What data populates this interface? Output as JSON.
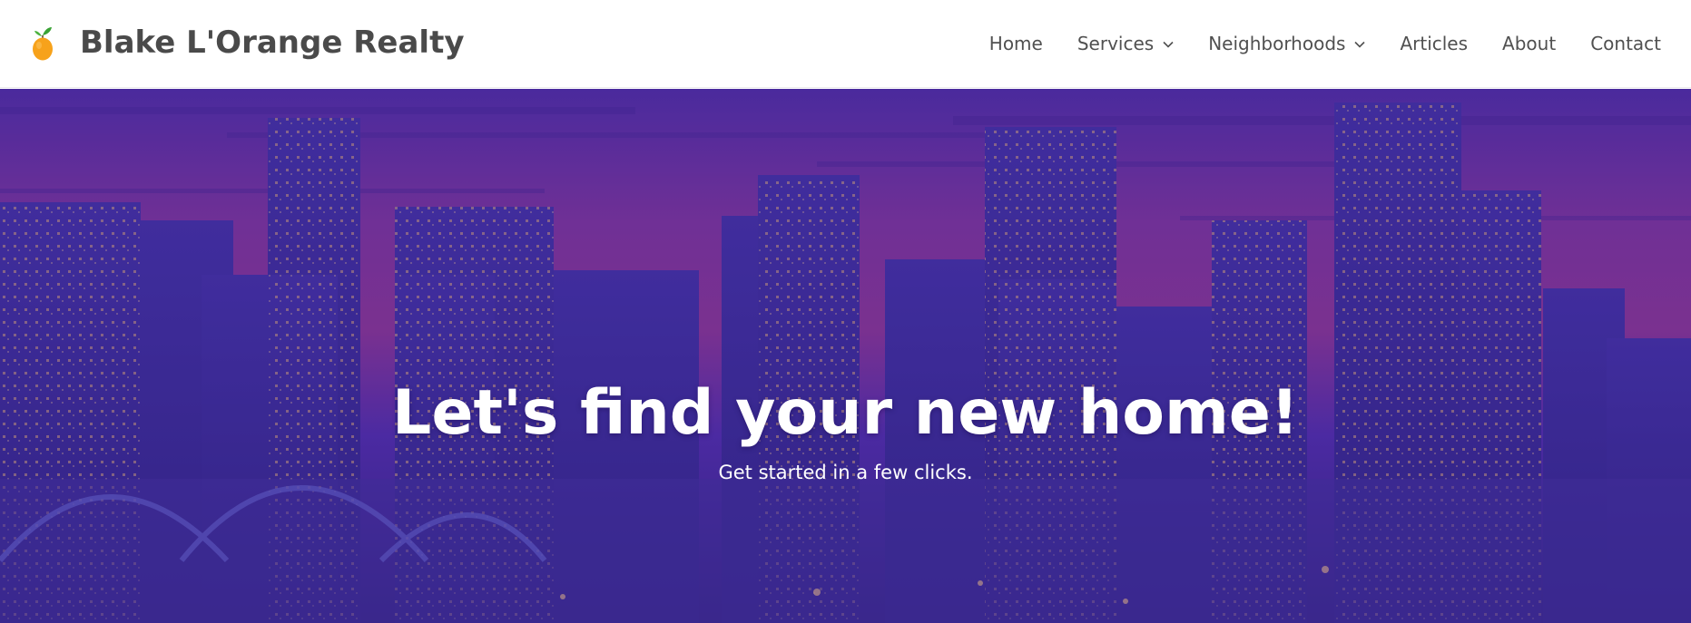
{
  "brand": {
    "name": "Blake L'Orange Realty",
    "logo_icon": "orange-fruit-icon",
    "logo_color": "#f7a21b",
    "leaf_color": "#3aa335"
  },
  "nav": {
    "items": [
      {
        "label": "Home",
        "has_dropdown": false
      },
      {
        "label": "Services",
        "has_dropdown": true
      },
      {
        "label": "Neighborhoods",
        "has_dropdown": true
      },
      {
        "label": "Articles",
        "has_dropdown": false
      },
      {
        "label": "About",
        "has_dropdown": false
      },
      {
        "label": "Contact",
        "has_dropdown": false
      }
    ]
  },
  "hero": {
    "title": "Let's find your new home!",
    "subtitle": "Get started in a few clicks.",
    "background": "city-skyline-night-image",
    "overlay_color": "#4b2aa8"
  }
}
